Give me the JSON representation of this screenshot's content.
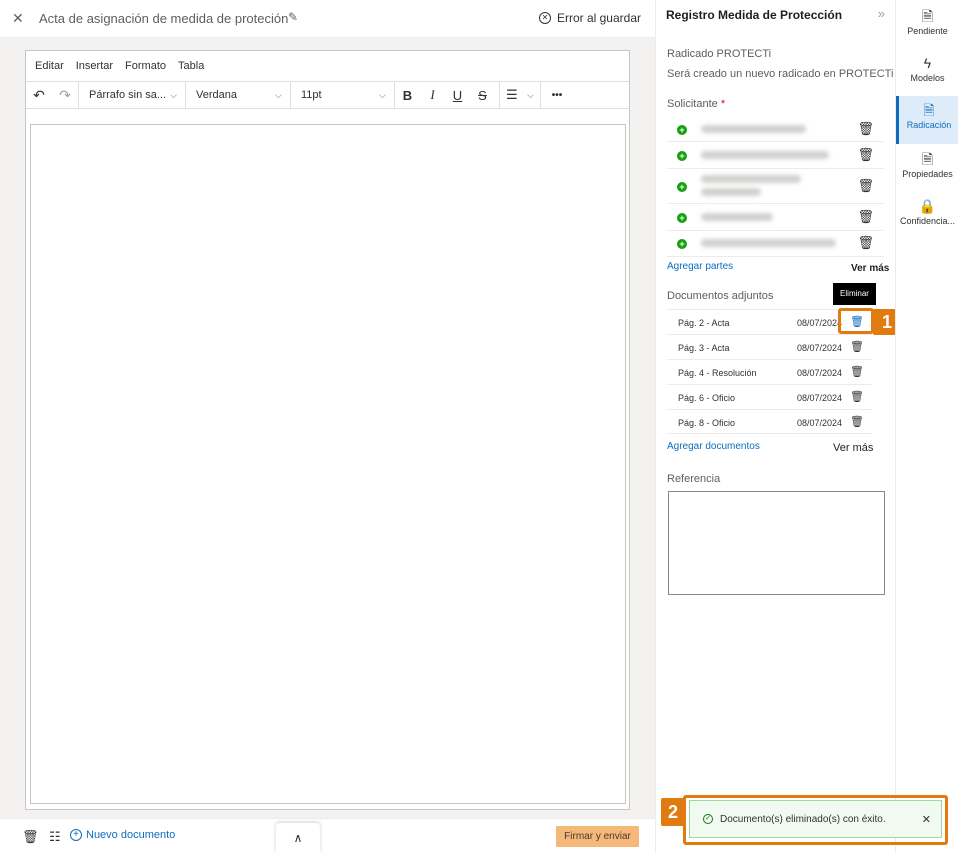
{
  "header": {
    "close_icon": "close-icon",
    "title": "Acta de asignación de medida de proteción",
    "save_status": "Error al guardar"
  },
  "editor": {
    "menu": [
      "Editar",
      "Insertar",
      "Formato",
      "Tabla"
    ],
    "paragraph_style": "Párrafo sin sa...",
    "font": "Verdana",
    "font_size": "11pt",
    "bold": "B",
    "italic": "I",
    "underline": "U",
    "strike": "S",
    "more": "•••"
  },
  "bottom_bar": {
    "new_document": "Nuevo documento",
    "sign_and_send": "Firmar y enviar"
  },
  "panel": {
    "title": "Registro Medida de Protección",
    "radicado_label": "Radicado PROTECTi",
    "radicado_value": "Será creado un nuevo radicado en PROTECTi",
    "solicitante_label": "Solicitante",
    "required_mark": "*",
    "add_parties": "Agregar partes",
    "see_more": "Ver más",
    "attachments_label": "Documentos adjuntos",
    "attachments": [
      {
        "name": "Pág. 2 - Acta",
        "date": "08/07/2024"
      },
      {
        "name": "Pág. 3 - Acta",
        "date": "08/07/2024"
      },
      {
        "name": "Pág. 4 - Resolución",
        "date": "08/07/2024"
      },
      {
        "name": "Pág. 6 - Oficio",
        "date": "08/07/2024"
      },
      {
        "name": "Pág. 8 - Oficio",
        "date": "08/07/2024"
      }
    ],
    "add_documents": "Agregar documentos",
    "see_more_docs": "Ver más",
    "reference_label": "Referencia",
    "tooltip": "Eliminar"
  },
  "sidenav": [
    {
      "label": "Pendiente",
      "icon": "pending-doc-icon"
    },
    {
      "label": "Modelos",
      "icon": "lightning-icon"
    },
    {
      "label": "Radicación",
      "icon": "radicacion-doc-icon"
    },
    {
      "label": "Propiedades",
      "icon": "properties-doc-icon"
    },
    {
      "label": "Confidencia...",
      "icon": "lock-icon"
    }
  ],
  "toast": {
    "message": "Documento(s) eliminado(s) con éxito."
  },
  "callouts": {
    "one": "1",
    "two": "2"
  },
  "colors": {
    "accent": "#0f6cbd",
    "callout": "#e07b10",
    "sign_button": "#f5b77a",
    "success": "#107c10"
  }
}
